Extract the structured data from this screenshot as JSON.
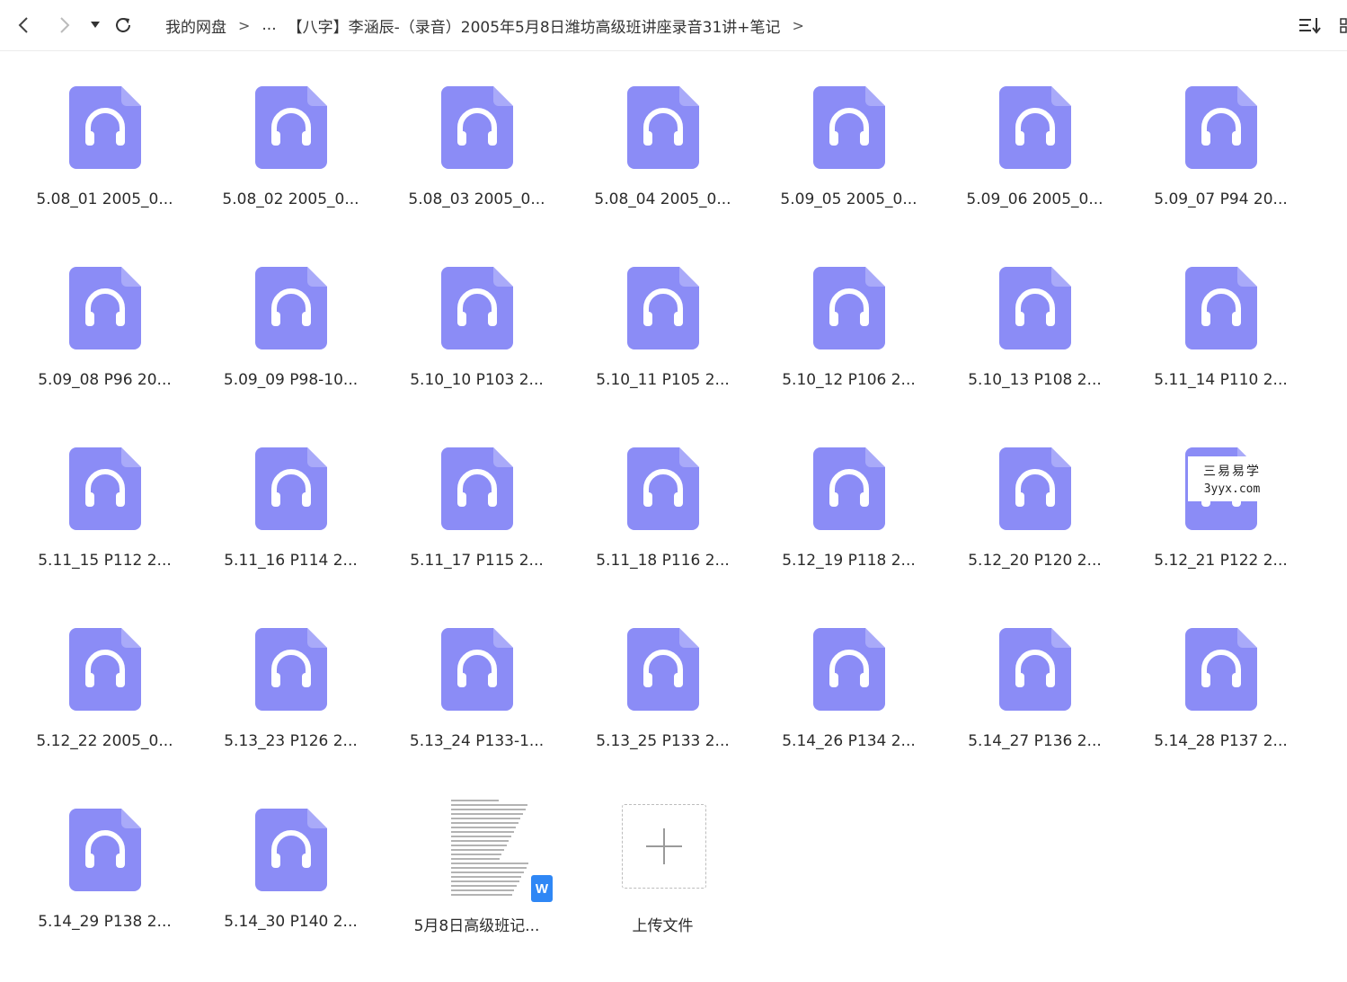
{
  "toolbar": {
    "back_icon": "chevron-left-icon",
    "forward_icon": "chevron-right-icon",
    "dropdown_icon": "caret-down-icon",
    "refresh_icon": "refresh-icon",
    "sort_icon": "sort-list-icon"
  },
  "breadcrumb": {
    "root": "我的网盘",
    "sep": ">",
    "ellipsis": "...",
    "current": "【八字】李涵辰-（录音）2005年5月8日潍坊高级班讲座录音31讲+笔记"
  },
  "files": [
    {
      "label": "5.08_01 2005_0...",
      "type": "audio"
    },
    {
      "label": "5.08_02 2005_0...",
      "type": "audio"
    },
    {
      "label": "5.08_03 2005_0...",
      "type": "audio"
    },
    {
      "label": "5.08_04 2005_0...",
      "type": "audio"
    },
    {
      "label": "5.09_05 2005_0...",
      "type": "audio"
    },
    {
      "label": "5.09_06 2005_0...",
      "type": "audio"
    },
    {
      "label": "5.09_07 P94 20...",
      "type": "audio"
    },
    {
      "label": "5.09_08 P96 20...",
      "type": "audio"
    },
    {
      "label": "5.09_09 P98-10...",
      "type": "audio"
    },
    {
      "label": "5.10_10 P103 2...",
      "type": "audio"
    },
    {
      "label": "5.10_11 P105 2...",
      "type": "audio"
    },
    {
      "label": "5.10_12 P106 2...",
      "type": "audio"
    },
    {
      "label": "5.10_13 P108 2...",
      "type": "audio"
    },
    {
      "label": "5.11_14 P110 2...",
      "type": "audio"
    },
    {
      "label": "5.11_15 P112 2...",
      "type": "audio"
    },
    {
      "label": "5.11_16 P114 2...",
      "type": "audio"
    },
    {
      "label": "5.11_17 P115 2...",
      "type": "audio"
    },
    {
      "label": "5.11_18 P116 2...",
      "type": "audio"
    },
    {
      "label": "5.12_19 P118 2...",
      "type": "audio"
    },
    {
      "label": "5.12_20 P120 2...",
      "type": "audio"
    },
    {
      "label": "5.12_21 P122 2...",
      "type": "audio"
    },
    {
      "label": "5.12_22 2005_0...",
      "type": "audio"
    },
    {
      "label": "5.13_23 P126 2...",
      "type": "audio"
    },
    {
      "label": "5.13_24 P133-1...",
      "type": "audio"
    },
    {
      "label": "5.13_25 P133 2...",
      "type": "audio"
    },
    {
      "label": "5.14_26 P134 2...",
      "type": "audio"
    },
    {
      "label": "5.14_27 P136 2...",
      "type": "audio"
    },
    {
      "label": "5.14_28 P137 2...",
      "type": "audio"
    },
    {
      "label": "5.14_29 P138 2...",
      "type": "audio"
    },
    {
      "label": "5.14_30 P140 2...",
      "type": "audio"
    },
    {
      "label": "5月8日高级班记...",
      "type": "doc",
      "badge": "W"
    },
    {
      "label": "上传文件",
      "type": "upload"
    }
  ],
  "watermark": {
    "line1": "三易易学",
    "line2": "3yyx.com"
  },
  "colors": {
    "audio_icon": "#8b8cf6",
    "audio_icon_fold": "#a9aaf9",
    "word_badge": "#2f87f5"
  }
}
